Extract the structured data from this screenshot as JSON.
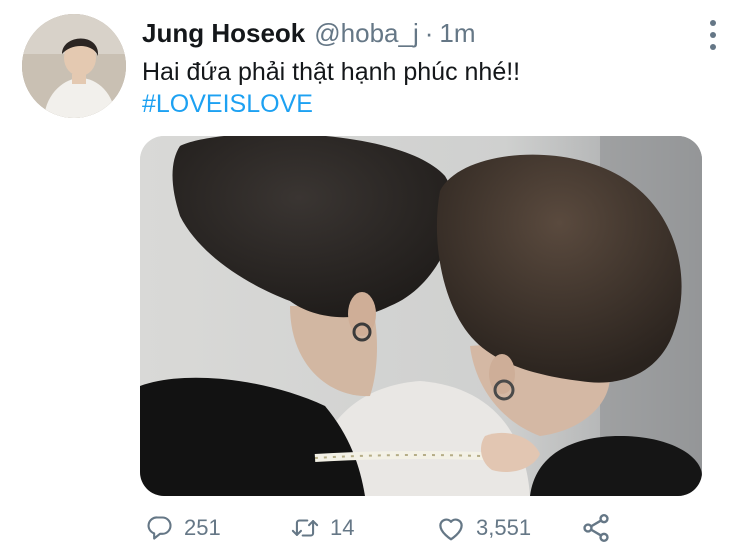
{
  "tweet": {
    "author_name": "Jung Hoseok",
    "author_handle": "@hoba_j",
    "separator": "·",
    "timestamp": "1m",
    "text": "Hai đứa phải thật hạnh phúc nhé!!",
    "hashtag": "#LOVEISLOVE"
  },
  "actions": {
    "reply_count": "251",
    "retweet_count": "14",
    "like_count": "3,551"
  },
  "icons": {
    "more": "more-vertical-icon",
    "reply": "reply-icon",
    "retweet": "retweet-icon",
    "like": "heart-icon",
    "share": "share-icon"
  },
  "colors": {
    "link": "#1da1f2",
    "muted": "#657786",
    "text": "#14171a"
  }
}
